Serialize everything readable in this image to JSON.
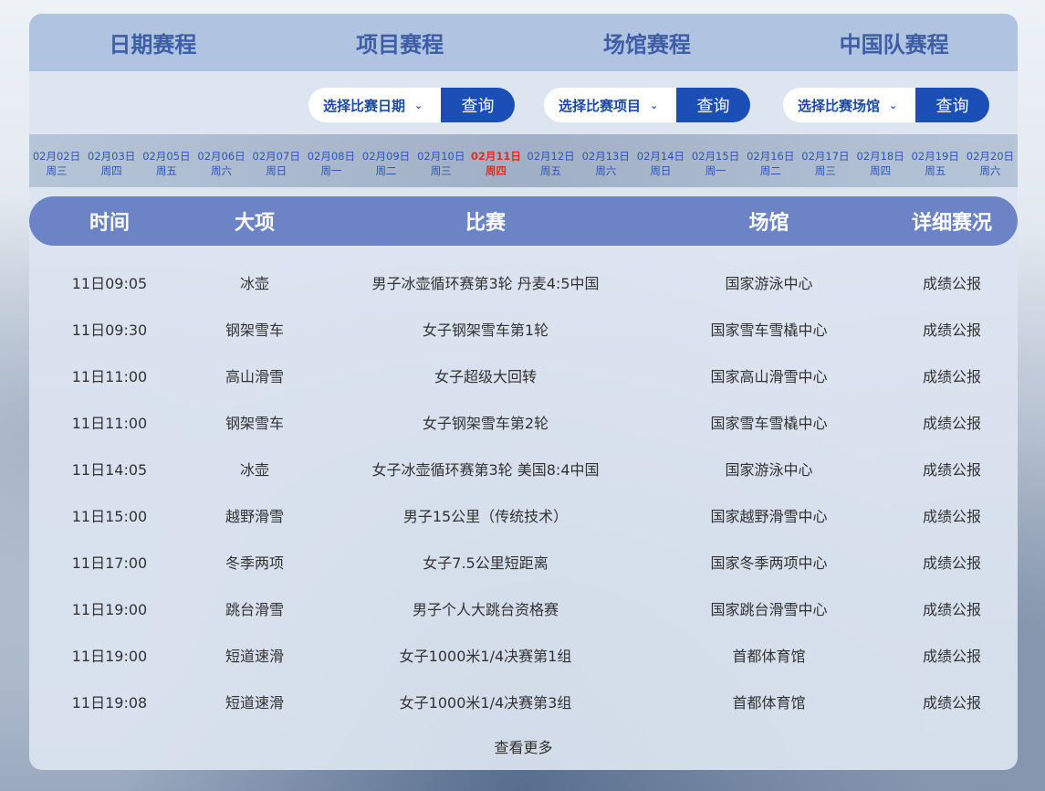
{
  "tabs": [
    "日期赛程",
    "项目赛程",
    "场馆赛程",
    "中国队赛程"
  ],
  "filters": [
    {
      "label": "选择比赛日期",
      "button": "查询"
    },
    {
      "label": "选择比赛项目",
      "button": "查询"
    },
    {
      "label": "选择比赛场馆",
      "button": "查询"
    }
  ],
  "dates": [
    {
      "date": "02月02日",
      "weekday": "周三"
    },
    {
      "date": "02月03日",
      "weekday": "周四"
    },
    {
      "date": "02月05日",
      "weekday": "周五"
    },
    {
      "date": "02月06日",
      "weekday": "周六"
    },
    {
      "date": "02月07日",
      "weekday": "周日"
    },
    {
      "date": "02月08日",
      "weekday": "周一"
    },
    {
      "date": "02月09日",
      "weekday": "周二"
    },
    {
      "date": "02月10日",
      "weekday": "周三"
    },
    {
      "date": "02月11日",
      "weekday": "周四",
      "active": true
    },
    {
      "date": "02月12日",
      "weekday": "周五"
    },
    {
      "date": "02月13日",
      "weekday": "周六"
    },
    {
      "date": "02月14日",
      "weekday": "周日"
    },
    {
      "date": "02月15日",
      "weekday": "周一"
    },
    {
      "date": "02月16日",
      "weekday": "周二"
    },
    {
      "date": "02月17日",
      "weekday": "周三"
    },
    {
      "date": "02月18日",
      "weekday": "周四"
    },
    {
      "date": "02月19日",
      "weekday": "周五"
    },
    {
      "date": "02月20日",
      "weekday": "周六"
    }
  ],
  "table": {
    "headers": [
      "时间",
      "大项",
      "比赛",
      "场馆",
      "详细赛况"
    ],
    "rows": [
      [
        "11日09:05",
        "冰壶",
        "男子冰壶循环赛第3轮 丹麦4:5中国",
        "国家游泳中心",
        "成绩公报"
      ],
      [
        "11日09:30",
        "钢架雪车",
        "女子钢架雪车第1轮",
        "国家雪车雪橇中心",
        "成绩公报"
      ],
      [
        "11日11:00",
        "高山滑雪",
        "女子超级大回转",
        "国家高山滑雪中心",
        "成绩公报"
      ],
      [
        "11日11:00",
        "钢架雪车",
        "女子钢架雪车第2轮",
        "国家雪车雪橇中心",
        "成绩公报"
      ],
      [
        "11日14:05",
        "冰壶",
        "女子冰壶循环赛第3轮 美国8:4中国",
        "国家游泳中心",
        "成绩公报"
      ],
      [
        "11日15:00",
        "越野滑雪",
        "男子15公里（传统技术）",
        "国家越野滑雪中心",
        "成绩公报"
      ],
      [
        "11日17:00",
        "冬季两项",
        "女子7.5公里短距离",
        "国家冬季两项中心",
        "成绩公报"
      ],
      [
        "11日19:00",
        "跳台滑雪",
        "男子个人大跳台资格赛",
        "国家跳台滑雪中心",
        "成绩公报"
      ],
      [
        "11日19:00",
        "短道速滑",
        "女子1000米1/4决赛第1组",
        "首都体育馆",
        "成绩公报"
      ],
      [
        "11日19:08",
        "短道速滑",
        "女子1000米1/4决赛第3组",
        "首都体育馆",
        "成绩公报"
      ]
    ]
  },
  "more": "查看更多"
}
